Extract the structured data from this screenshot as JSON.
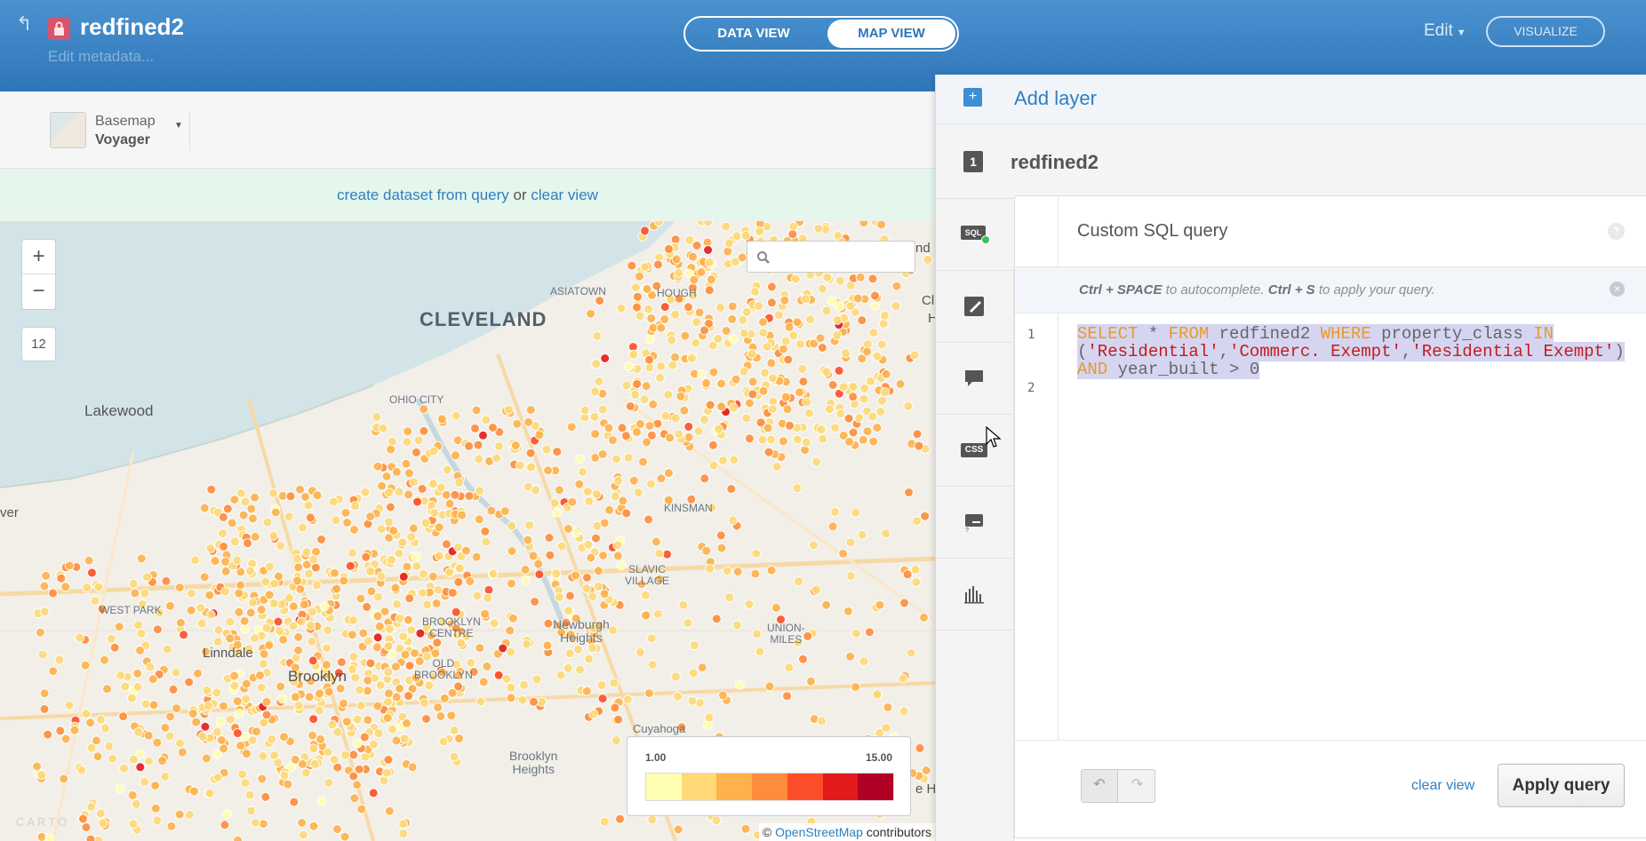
{
  "header": {
    "title": "redfined2",
    "edit_metadata": "Edit metadata...",
    "data_view": "DATA VIEW",
    "map_view": "MAP VIEW",
    "edit": "Edit",
    "visualize": "VISUALIZE"
  },
  "basemap": {
    "label": "Basemap",
    "name": "Voyager"
  },
  "notice": {
    "create_link": "create dataset from query",
    "or": " or ",
    "clear_link": "clear view"
  },
  "map": {
    "zoom_in": "+",
    "zoom_out": "−",
    "zoom_level": "12",
    "search_placeholder": "",
    "labels": {
      "cleveland": "CLEVELAND",
      "lakewood": "Lakewood",
      "asiatown": "ASIATOWN",
      "hough": "HOUGH",
      "ohio_city": "OHIO CITY",
      "kinsman": "KINSMAN",
      "slavic_village": "SLAVIC\nVILLAGE",
      "west_park": "WEST PARK",
      "linndale": "Linndale",
      "brooklyn_centre": "BROOKLYN\nCENTRE",
      "newburgh_heights": "Newburgh\nHeights",
      "union_miles": "UNION-\nMILES",
      "old_brooklyn": "OLD\nBROOKLYN",
      "brooklyn": "Brooklyn",
      "cuyahoga": "Cuyahoga",
      "brooklyn_heights": "Brooklyn\nHeights",
      "ver": "ver",
      "nd": "nd",
      "cl": "Cl",
      "h": "H",
      "e_he": "e He"
    },
    "legend": {
      "min": "1.00",
      "max": "15.00",
      "colors": [
        "#ffffb2",
        "#fed976",
        "#feb24c",
        "#fd8d3c",
        "#fc4e2a",
        "#e31a1c",
        "#b10026"
      ]
    },
    "attribution_prefix": "© ",
    "attribution_link": "OpenStreetMap",
    "attribution_suffix": " contributors"
  },
  "panel": {
    "add_layer": "Add layer",
    "layer_number": "1",
    "layer_name": "redfined2",
    "editor_title": "Custom SQL query",
    "help": "?",
    "hint_key1": "Ctrl + SPACE",
    "hint_text1": " to autocomplete. ",
    "hint_key2": "Ctrl + S",
    "hint_text2": " to apply your query.",
    "line1": "1",
    "line2": "2",
    "sql": {
      "select": "SELECT",
      "star_from": " * ",
      "from": "FROM",
      "table": " redfined2 ",
      "where": "WHERE",
      "col": " property_class ",
      "in": "IN",
      "open": "(",
      "v1": "'Residential'",
      "c1": ",",
      "v2": "'Commerc. Exempt'",
      "c2": ",",
      "v3": "'Residential Exempt'",
      "close": ") ",
      "and": "AND",
      "cond": " year_built > 0"
    },
    "tools": {
      "sql": "SQL",
      "css": "CSS"
    },
    "undo": "↶",
    "redo": "↷",
    "clear_view": "clear view",
    "apply_query": "Apply query"
  }
}
